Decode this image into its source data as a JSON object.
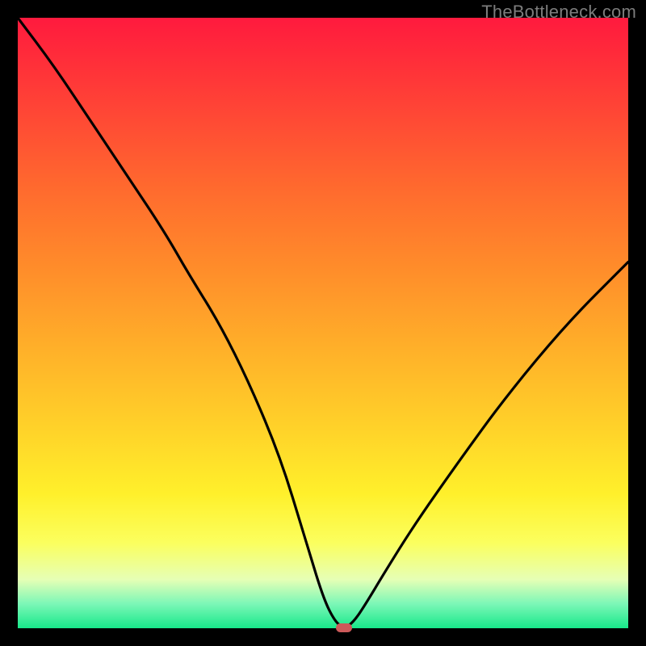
{
  "watermark": "TheBottleneck.com",
  "chart_data": {
    "type": "line",
    "title": "",
    "xlabel": "",
    "ylabel": "",
    "xlim": [
      0,
      100
    ],
    "ylim": [
      0,
      100
    ],
    "series": [
      {
        "name": "curve",
        "x": [
          0,
          6,
          12,
          18,
          24,
          28,
          33,
          38,
          43,
          47,
          50,
          52,
          53.5,
          55,
          57,
          60,
          65,
          72,
          80,
          90,
          100
        ],
        "y": [
          100,
          92,
          83,
          74,
          65,
          58,
          50,
          40,
          28,
          15,
          5,
          1,
          0,
          1,
          4,
          9,
          17,
          27,
          38,
          50,
          60
        ]
      }
    ],
    "marker": {
      "x": 53.5,
      "y": 0,
      "color": "#cc5a5a"
    },
    "background_gradient": {
      "type": "vertical",
      "stops": [
        {
          "pos": 0.0,
          "color": "#ff1a3e"
        },
        {
          "pos": 0.28,
          "color": "#ff6a2e"
        },
        {
          "pos": 0.55,
          "color": "#ffb229"
        },
        {
          "pos": 0.78,
          "color": "#fff02b"
        },
        {
          "pos": 0.92,
          "color": "#e6ffb5"
        },
        {
          "pos": 1.0,
          "color": "#17e88a"
        }
      ]
    }
  }
}
